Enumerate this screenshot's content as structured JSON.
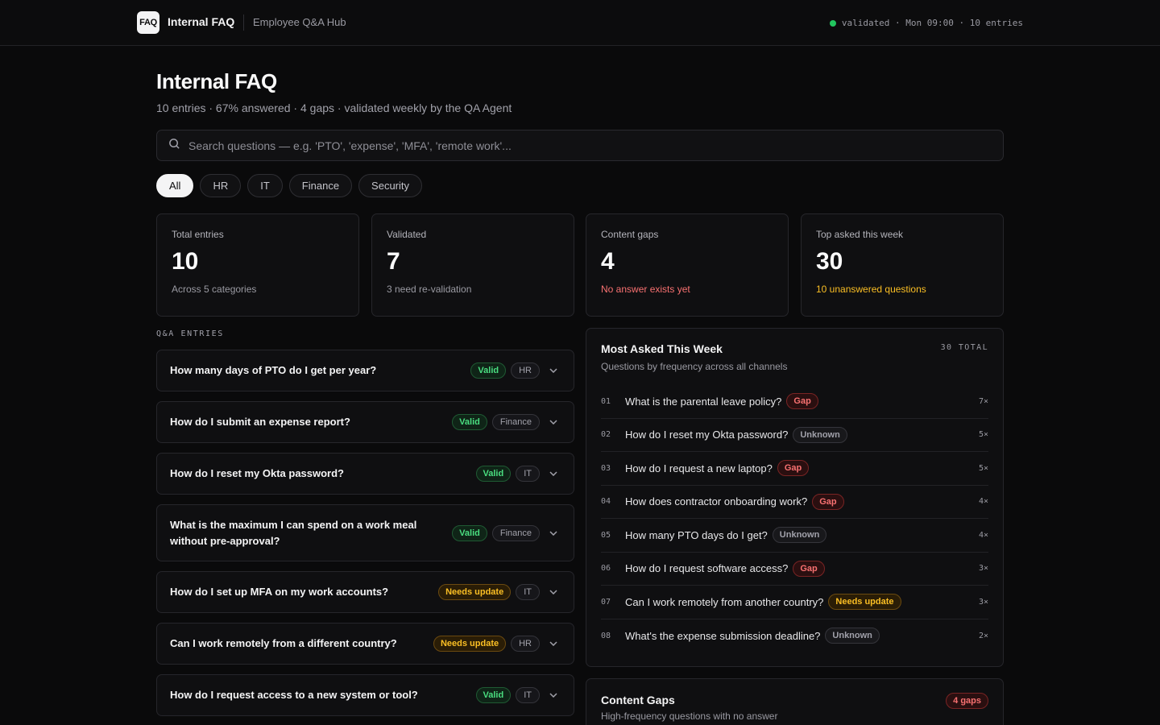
{
  "topbar": {
    "logo": "FAQ",
    "brand": "Internal FAQ",
    "subtitle": "Employee Q&A Hub",
    "status": "validated · Mon 09:00 · 10 entries",
    "status_color": "#22c55e"
  },
  "header": {
    "title": "Internal FAQ",
    "subtitle": "10 entries · 67% answered · 4 gaps · validated weekly by the QA Agent"
  },
  "search": {
    "placeholder": "Search questions — e.g. 'PTO', 'expense', 'MFA', 'remote work'...",
    "value": ""
  },
  "filters": [
    "All",
    "HR",
    "IT",
    "Finance",
    "Security"
  ],
  "active_filter": "All",
  "stats": [
    {
      "label": "Total entries",
      "value": "10",
      "note": "Across 5 categories"
    },
    {
      "label": "Validated",
      "value": "7",
      "note": "3 need re-validation"
    },
    {
      "label": "Content gaps",
      "value": "4",
      "note": "No answer exists yet"
    },
    {
      "label": "Top asked this week",
      "value": "30",
      "note": "10 unanswered questions"
    }
  ],
  "qa_section_label": "Q&A ENTRIES",
  "qa_entries": [
    {
      "question": "How many days of PTO do I get per year?",
      "status": "Valid",
      "category": "HR"
    },
    {
      "question": "How do I submit an expense report?",
      "status": "Valid",
      "category": "Finance"
    },
    {
      "question": "How do I reset my Okta password?",
      "status": "Valid",
      "category": "IT"
    },
    {
      "question": "What is the maximum I can spend on a work meal without pre-approval?",
      "status": "Valid",
      "category": "Finance"
    },
    {
      "question": "How do I set up MFA on my work accounts?",
      "status": "Needs update",
      "category": "IT"
    },
    {
      "question": "Can I work remotely from a different country?",
      "status": "Needs update",
      "category": "HR"
    },
    {
      "question": "How do I request access to a new system or tool?",
      "status": "Valid",
      "category": "IT"
    }
  ],
  "most_asked": {
    "title": "Most Asked This Week",
    "subtitle": "Questions by frequency across all channels",
    "total": "30 TOTAL",
    "rows": [
      {
        "num": "01",
        "question": "What is the parental leave policy?",
        "status": "Gap",
        "count": "7×"
      },
      {
        "num": "02",
        "question": "How do I reset my Okta password?",
        "status": "Unknown",
        "count": "5×"
      },
      {
        "num": "03",
        "question": "How do I request a new laptop?",
        "status": "Gap",
        "count": "5×"
      },
      {
        "num": "04",
        "question": "How does contractor onboarding work?",
        "status": "Gap",
        "count": "4×"
      },
      {
        "num": "05",
        "question": "How many PTO days do I get?",
        "status": "Unknown",
        "count": "4×"
      },
      {
        "num": "06",
        "question": "How do I request software access?",
        "status": "Gap",
        "count": "3×"
      },
      {
        "num": "07",
        "question": "Can I work remotely from another country?",
        "status": "Needs update",
        "count": "3×"
      },
      {
        "num": "08",
        "question": "What's the expense submission deadline?",
        "status": "Unknown",
        "count": "2×"
      }
    ]
  },
  "content_gaps": {
    "title": "Content Gaps",
    "subtitle": "High-frequency questions with no answer",
    "badge": "4 gaps"
  }
}
